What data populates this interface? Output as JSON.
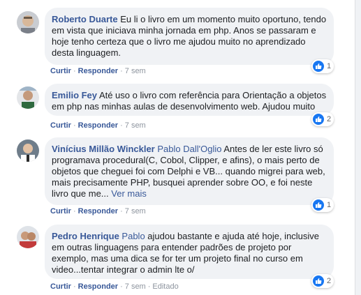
{
  "comments": [
    {
      "author": "Roberto Duarte",
      "tag": "",
      "text": "Eu li o livro em um momento muito oportuno, tendo em vista que iniciava minha jornada em php. Anos se passaram e hoje tenho certeza que o livro me ajudou muito no aprendizado desta linguagem.",
      "more": "",
      "like_label": "Curtir",
      "reply_label": "Responder",
      "time": "7 sem",
      "edited": "",
      "reaction_count": "1"
    },
    {
      "author": "Emilio Fey",
      "tag": "",
      "text": "Até uso o livro com referência para Orientação a objetos em php nas minhas aulas de desenvolvimento web. Ajudou muito",
      "more": "",
      "like_label": "Curtir",
      "reply_label": "Responder",
      "time": "7 sem",
      "edited": "",
      "reaction_count": "2"
    },
    {
      "author": "Vinícius Millão Winckler",
      "tag": "Pablo Dall'Oglio",
      "text": "Antes de ler este livro só programava procedural(C, Cobol, Clipper, e afins), o mais perto de objetos que cheguei foi com Delphi e VB... quando migrei para web, mais precisamente PHP, busquei aprender sobre OO, e foi neste livro que me...",
      "more": "Ver mais",
      "like_label": "Curtir",
      "reply_label": "Responder",
      "time": "7 sem",
      "edited": "",
      "reaction_count": "1"
    },
    {
      "author": "Pedro Henrique",
      "tag": "Pablo",
      "text": "ajudou bastante e ajuda até hoje, inclusive em outras linguagens para entender padrões de projeto por exemplo, mas uma dica se for ter um projeto final no curso em video...tentar integrar o admin lte o/",
      "more": "",
      "like_label": "Curtir",
      "reply_label": "Responder",
      "time": "7 sem",
      "edited": "Editado",
      "reaction_count": "2"
    }
  ],
  "colors": {
    "link": "#385898",
    "bubble": "#f0f2f5",
    "like_blue": "#1877f2",
    "meta": "#8d949e"
  },
  "icons": {
    "reaction": "thumbs-up-icon"
  }
}
